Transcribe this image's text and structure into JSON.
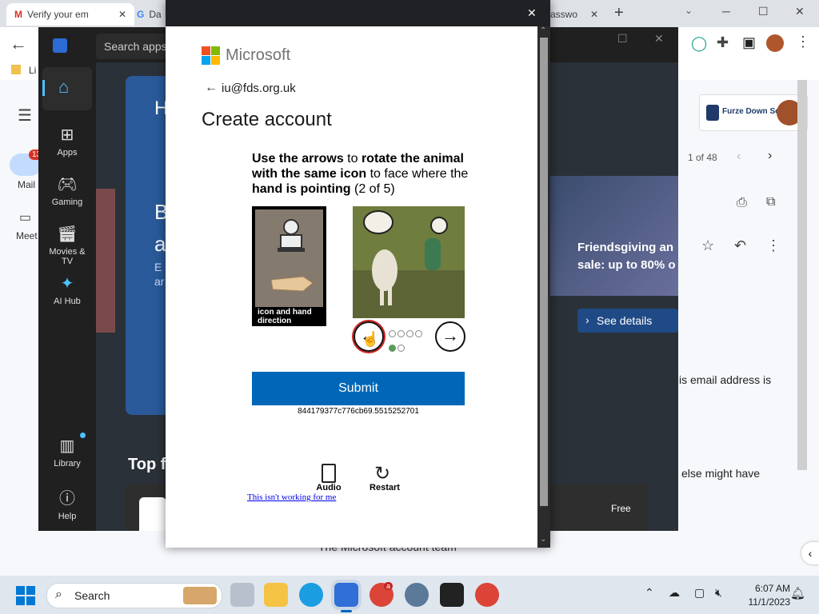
{
  "browser": {
    "tabs": [
      {
        "label": "Verify your em",
        "icon": "gmail-icon"
      },
      {
        "label": "Da",
        "icon": "google-icon"
      },
      {
        "label": "asswo",
        "icon": ""
      }
    ],
    "new_tab": "+",
    "back": "←",
    "bookmark_partial": "Li",
    "win_min": "─",
    "win_max": "☐",
    "win_close": "✕"
  },
  "gmail": {
    "unread_count": "13",
    "mail_label": "Mail",
    "meet_label": "Meet",
    "pager": "1 of 48",
    "school_name": "Furze Down School",
    "text1": "is email address is",
    "text2": "else might have",
    "footer_partial": "The Microsoft account team"
  },
  "store": {
    "search_placeholder": "Search apps",
    "rail": [
      {
        "label": "",
        "icon": "home-icon"
      },
      {
        "label": "Apps",
        "icon": "apps-icon"
      },
      {
        "label": "Gaming",
        "icon": "gaming-icon"
      },
      {
        "label": "Movies & TV",
        "icon": "movies-icon"
      },
      {
        "label": "AI Hub",
        "icon": "ai-hub-icon"
      },
      {
        "label": "Library",
        "icon": "library-icon"
      },
      {
        "label": "Help",
        "icon": "help-icon"
      }
    ],
    "hero_h": "H",
    "hero_b": "B",
    "hero_a": "a",
    "hero_e": "E",
    "hero_ar": "ar",
    "promo_title": "Friendsgiving an",
    "promo_sub": "sale: up to 80% o",
    "see_details": "See details",
    "top_free": "Top f",
    "free_label": "Free"
  },
  "dialog": {
    "close": "✕",
    "brand": "Microsoft",
    "back_arrow": "←",
    "email": "iu@fds.org.uk",
    "title": "Create account",
    "instr_1": "Use the arrows",
    "instr_2": " to ",
    "instr_3": "rotate the animal with the same icon",
    "instr_4": " to face where the ",
    "instr_5": "hand is pointing",
    "instr_6": " (2 of 5)",
    "caption": "icon and hand direction",
    "progress_current": 4,
    "progress_total": 6,
    "submit": "Submit",
    "captcha_id": "844179377c776cb69.5515252701",
    "audio": "Audio",
    "restart": "Restart",
    "not_working": "This isn't working for me"
  },
  "taskbar": {
    "search": "Search",
    "time": "6:07 AM",
    "date": "11/1/2023",
    "chrome_badge": "a"
  }
}
